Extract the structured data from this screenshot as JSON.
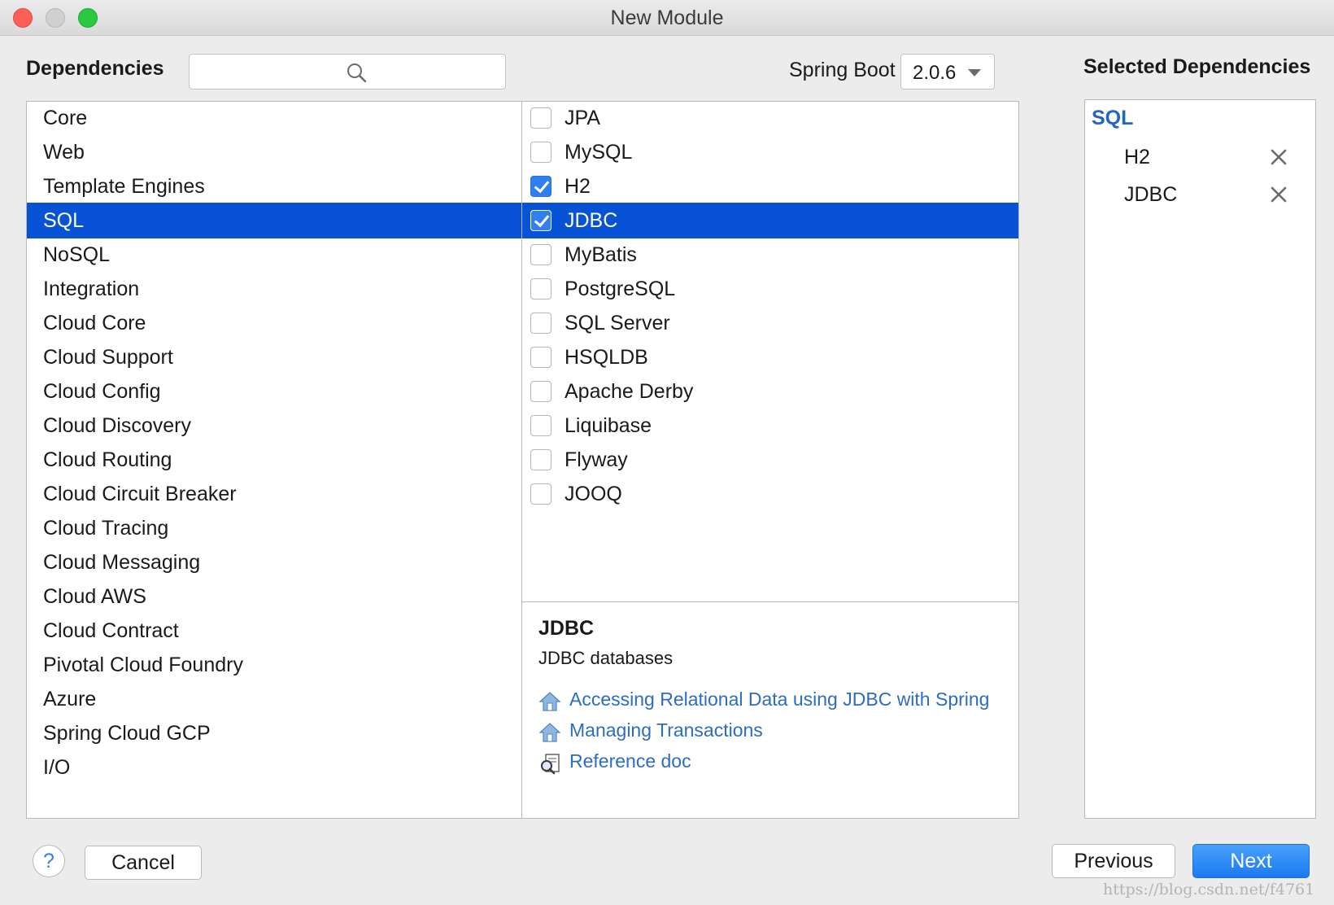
{
  "window": {
    "title": "New Module"
  },
  "header": {
    "dependencies_label": "Dependencies",
    "search_placeholder": "",
    "spring_boot_label": "Spring Boot",
    "spring_boot_version": "2.0.6",
    "selected_label": "Selected Dependencies"
  },
  "categories": [
    "Core",
    "Web",
    "Template Engines",
    "SQL",
    "NoSQL",
    "Integration",
    "Cloud Core",
    "Cloud Support",
    "Cloud Config",
    "Cloud Discovery",
    "Cloud Routing",
    "Cloud Circuit Breaker",
    "Cloud Tracing",
    "Cloud Messaging",
    "Cloud AWS",
    "Cloud Contract",
    "Pivotal Cloud Foundry",
    "Azure",
    "Spring Cloud GCP",
    "I/O"
  ],
  "selected_category": "SQL",
  "dependencies": [
    {
      "label": "JPA",
      "checked": false
    },
    {
      "label": "MySQL",
      "checked": false
    },
    {
      "label": "H2",
      "checked": true
    },
    {
      "label": "JDBC",
      "checked": true
    },
    {
      "label": "MyBatis",
      "checked": false
    },
    {
      "label": "PostgreSQL",
      "checked": false
    },
    {
      "label": "SQL Server",
      "checked": false
    },
    {
      "label": "HSQLDB",
      "checked": false
    },
    {
      "label": "Apache Derby",
      "checked": false
    },
    {
      "label": "Liquibase",
      "checked": false
    },
    {
      "label": "Flyway",
      "checked": false
    },
    {
      "label": "JOOQ",
      "checked": false
    }
  ],
  "selected_dependency": "JDBC",
  "description": {
    "title": "JDBC",
    "text": "JDBC databases",
    "links": [
      {
        "label": "Accessing Relational Data using JDBC with Spring",
        "icon": "guide-house-icon"
      },
      {
        "label": "Managing Transactions",
        "icon": "guide-house-icon"
      },
      {
        "label": "Reference doc",
        "icon": "reference-doc-icon"
      }
    ]
  },
  "selected": {
    "group": "SQL",
    "items": [
      "H2",
      "JDBC"
    ]
  },
  "footer": {
    "help_label": "?",
    "cancel_label": "Cancel",
    "previous_label": "Previous",
    "next_label": "Next"
  },
  "watermark": "https://blog.csdn.net/f4761",
  "colors": {
    "selection": "#0852d6",
    "checkbox_checked": "#2f7ff0",
    "link": "#2b6cc4",
    "group_label": "#1f66c4",
    "next_button": "#1a7af2"
  }
}
